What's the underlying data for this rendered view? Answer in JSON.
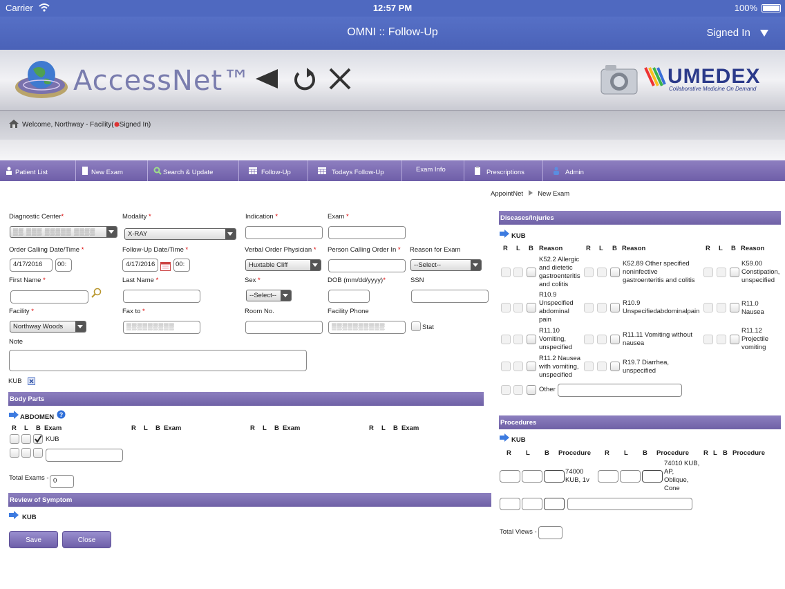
{
  "status_bar": {
    "carrier": "Carrier",
    "time": "12:57 PM",
    "battery": "100%"
  },
  "title_bar": {
    "title": "OMNI :: Follow-Up",
    "signed_in": "Signed In"
  },
  "header": {
    "logo_text": "AccessNet™",
    "partner_text": "UMEDEX",
    "partner_sub": "Collaborative Medicine On Demand"
  },
  "welcome": {
    "text": "Welcome, Northway - Facility(",
    "status": "Signed In)"
  },
  "menu": [
    "Patient List",
    "New Exam",
    "Search & Update",
    "Follow-Up",
    "Todays Follow-Up",
    "Exam Info",
    "Prescriptions",
    "Admin"
  ],
  "breadcrumb": {
    "root": "AppointNet",
    "current": "New Exam"
  },
  "form": {
    "diagnostic_center_label": "Diagnostic Center",
    "diagnostic_center_value": "▒▒ ▒▒▒ ▒▒▒▒▒ ▒▒▒▒",
    "modality_label": "Modality",
    "modality_value": "X-RAY",
    "indication_label": "Indication",
    "exam_label": "Exam",
    "order_calling_label": "Order Calling Date/Time",
    "order_date": "4/17/2016",
    "order_time": "00:",
    "followup_label": "Follow-Up Date/Time",
    "followup_date": "4/17/2016",
    "followup_time": "00:",
    "verbal_order_label": "Verbal Order Physician",
    "verbal_order_value": "Huxtable Cliff",
    "person_calling_label": "Person Calling Order In",
    "reason_label": "Reason for Exam",
    "reason_value": "--Select--",
    "first_name_label": "First Name",
    "last_name_label": "Last Name",
    "sex_label": "Sex",
    "sex_value": "--Select--",
    "dob_label": "DOB (mm/dd/yyyy)",
    "ssn_label": "SSN",
    "facility_label": "Facility",
    "facility_value": "Northway Woods",
    "fax_label": "Fax to",
    "fax_value": "▒▒▒▒▒▒▒▒▒",
    "room_label": "Room No.",
    "facility_phone_label": "Facility Phone",
    "facility_phone_value": "▒▒▒▒▒▒▒▒▒▒",
    "stat_label": "Stat",
    "note_label": "Note",
    "exam_tag": "KUB"
  },
  "body_parts": {
    "title": "Body Parts",
    "region": "ABDOMEN",
    "headers": [
      "R",
      "L",
      "B",
      "Exam"
    ],
    "row_exam": "KUB",
    "total_exams_label": "Total Exams -",
    "total_exams_value": "0"
  },
  "review": {
    "title": "Review of Symptom",
    "item": "KUB"
  },
  "buttons": {
    "save": "Save",
    "close": "Close"
  },
  "diseases": {
    "title": "Diseases/Injuries",
    "group": "KUB",
    "headers": [
      "R",
      "L",
      "B",
      "Reason"
    ],
    "col1": [
      "K52.2 Allergic and dietetic gastroenteritis and colitis",
      "R10.9 Unspecified abdominal pain",
      "R11.10 Vomiting, unspecified",
      "R11.2 Nausea with vomiting, unspecified"
    ],
    "col2": [
      "K52.89 Other specified noninfective gastroenteritis and colitis",
      "R10.9 Unspecifiedabdominalpain",
      "R11.11 Vomiting without nausea",
      "R19.7 Diarrhea, unspecified"
    ],
    "col3": [
      "K59.00 Constipation, unspecified",
      "R11.0 Nausea",
      "R11.12 Projectile vomiting"
    ],
    "other_label": "Other"
  },
  "procedures": {
    "title": "Procedures",
    "group": "KUB",
    "headers": [
      "R",
      "L",
      "B",
      "Procedure"
    ],
    "p1": "74000 KUB, 1v",
    "p2": "74010 KUB, AP, Oblique, Cone",
    "total_views_label": "Total Views -"
  },
  "colors": {
    "title_bar": "#4f69c0",
    "menu_bar": "#7a6bb3",
    "section_bar": "#7d70b2",
    "required": "#dd0000"
  }
}
